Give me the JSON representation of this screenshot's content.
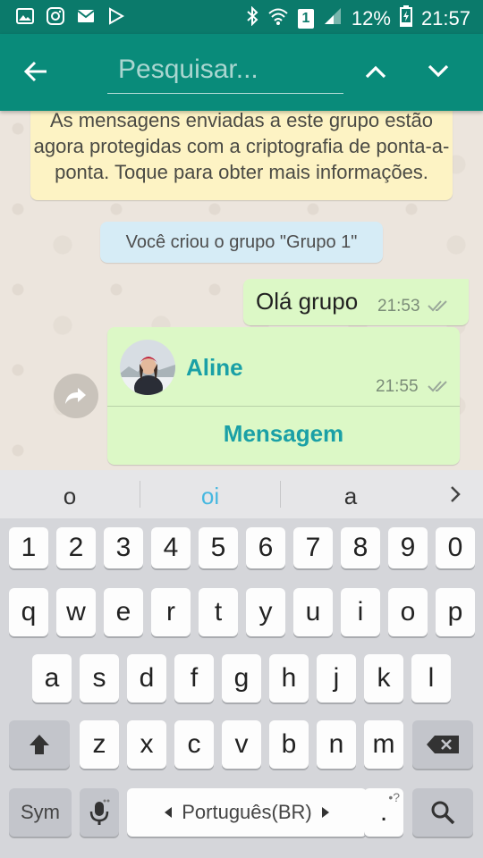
{
  "status_bar": {
    "battery": "12%",
    "time": "21:57",
    "sim": "1"
  },
  "toolbar": {
    "search_placeholder": "Pesquisar..."
  },
  "chat": {
    "encryption_notice": "As mensagens enviadas a este grupo estão agora protegidas com a criptografia de ponta-a-ponta. Toque para obter mais informações.",
    "system_message": "Você criou o grupo \"Grupo 1\"",
    "outgoing": {
      "text": "Olá grupo",
      "time": "21:53"
    },
    "contact_card": {
      "name": "Aline",
      "time": "21:55",
      "action": "Mensagem"
    }
  },
  "keyboard": {
    "suggestions": [
      "o",
      "oi",
      "a"
    ],
    "row_numbers": [
      "1",
      "2",
      "3",
      "4",
      "5",
      "6",
      "7",
      "8",
      "9",
      "0"
    ],
    "row1": [
      "q",
      "w",
      "e",
      "r",
      "t",
      "y",
      "u",
      "i",
      "o",
      "p"
    ],
    "row2": [
      "a",
      "s",
      "d",
      "f",
      "g",
      "h",
      "j",
      "k",
      "l"
    ],
    "row3": [
      "z",
      "x",
      "c",
      "v",
      "b",
      "n",
      "m"
    ],
    "sym_label": "Sym",
    "language_label": "Português(BR)",
    "period_label": "."
  },
  "colors": {
    "toolbar": "#098b7a",
    "status_bar": "#0b7a6b",
    "accent": "#1aa0a6",
    "outgoing_bubble": "#dcf8c6"
  }
}
